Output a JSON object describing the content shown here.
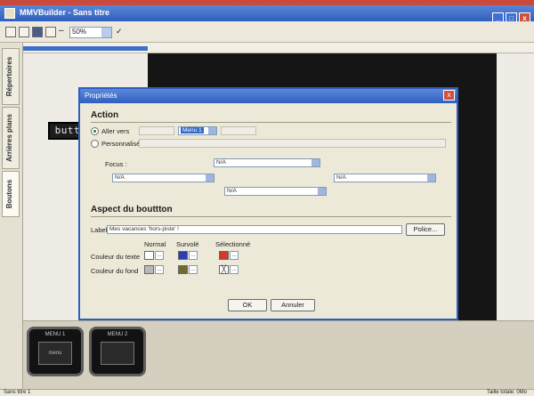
{
  "window": {
    "title": "MMVBuilder - Sans titre"
  },
  "toolbar": {
    "zoom_value": "50%"
  },
  "side_tabs": [
    "Répertoires",
    "Arrières plans",
    "Boutons"
  ],
  "canvas": {
    "preview_button_text": "button"
  },
  "dialog": {
    "title": "Propriétés",
    "close_label": "x",
    "action": {
      "heading": "Action",
      "radio_go_to": "Aller vers",
      "radio_custom": "Personnalisé",
      "go_to_value": "Menu 1",
      "focus_label": "Focus :",
      "nav_fields": [
        "N/A",
        "N/A",
        "N/A",
        "N/A"
      ]
    },
    "aspect": {
      "heading": "Aspect du bouttton",
      "label_caption": "Label:",
      "label_value": "Mes vacances 'hors-piste' !",
      "font_button": "Police...",
      "col_normal": "Normal",
      "col_hover": "Survolé",
      "col_selected": "Sélectionné",
      "row_text_color": "Couleur du texte",
      "row_bg_color": "Couleur du fond"
    },
    "ok_label": "OK",
    "cancel_label": "Annuler"
  },
  "thumbnails": [
    {
      "caption": "MENU 1",
      "inner": "menu"
    },
    {
      "caption": "MENU 2",
      "inner": ""
    }
  ],
  "status": {
    "left": "Sans titre 1",
    "right": "Taille totale: 0Mo"
  },
  "colors": {
    "text_normal": "#ffffff",
    "text_hover": "#2a3fb5",
    "text_selected": "#d23a2a",
    "bg_normal": "#b8b8b8",
    "bg_hover": "#6f6a2e",
    "bg_selected": "#ffffff"
  }
}
